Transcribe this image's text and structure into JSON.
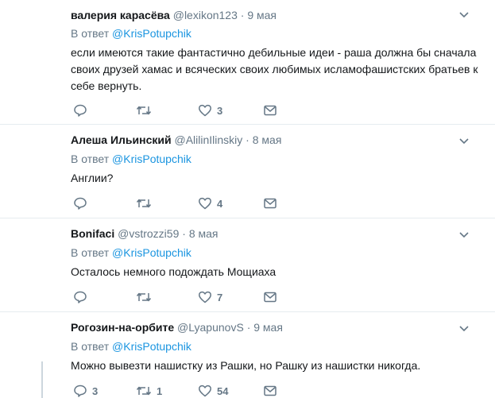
{
  "tweets": [
    {
      "name": "валерия карасёва",
      "handle": "@lexikon123",
      "dot": "·",
      "date": "9 мая",
      "reply_prefix": "В ответ",
      "reply_to": "@KrisPotupchik",
      "text": "если имеются такие фантастично дебильные идеи - раша должна бы сначала своих друзей хамас и всяческих своих любимых исламофашистских братьев к себе вернуть.",
      "replies": "",
      "retweets": "",
      "likes": "3"
    },
    {
      "name": "Алеша Ильинский",
      "handle": "@AlilinIlinskiy",
      "dot": "·",
      "date": "8 мая",
      "reply_prefix": "В ответ",
      "reply_to": "@KrisPotupchik",
      "text": "Англии?",
      "replies": "",
      "retweets": "",
      "likes": "4"
    },
    {
      "name": "Bonifaci",
      "handle": "@vstrozzi59",
      "dot": "·",
      "date": "8 мая",
      "reply_prefix": "В ответ",
      "reply_to": "@KrisPotupchik",
      "text": "Осталось немного подождать Мощиаха",
      "replies": "",
      "retweets": "",
      "likes": "7"
    },
    {
      "name": "Рогозин-на-орбите",
      "handle": "@LyapunovS",
      "dot": "·",
      "date": "9 мая",
      "reply_prefix": "В ответ",
      "reply_to": "@KrisPotupchik",
      "text": "Можно вывезти нашистку из Рашки, но Рашку из нашистки никогда.",
      "replies": "3",
      "retweets": "1",
      "likes": "54"
    }
  ],
  "icons": {
    "reply": "reply-icon",
    "retweet": "retweet-icon",
    "like": "heart-icon",
    "dm": "envelope-icon",
    "more": "chevron-down-icon"
  },
  "colors": {
    "name": "#14171a",
    "secondary": "#657786",
    "link": "#1b95e0",
    "divider": "#e6ecf0"
  }
}
